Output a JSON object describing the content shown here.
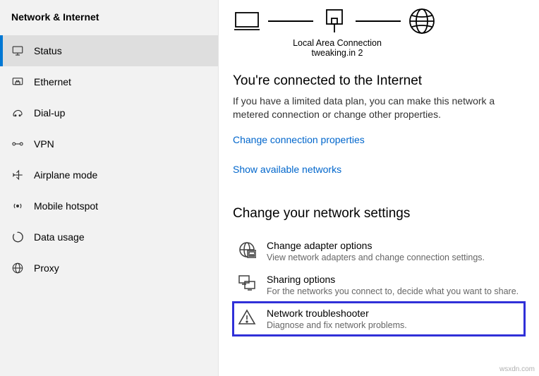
{
  "sidebar": {
    "title": "Network & Internet",
    "items": [
      {
        "label": "Status"
      },
      {
        "label": "Ethernet"
      },
      {
        "label": "Dial-up"
      },
      {
        "label": "VPN"
      },
      {
        "label": "Airplane mode"
      },
      {
        "label": "Mobile hotspot"
      },
      {
        "label": "Data usage"
      },
      {
        "label": "Proxy"
      }
    ]
  },
  "diagram": {
    "caption_line1": "Local Area Connection",
    "caption_line2": "tweaking.in 2"
  },
  "connected": {
    "heading": "You're connected to the Internet",
    "body": "If you have a limited data plan, you can make this network a metered connection or change other properties."
  },
  "links": {
    "change_props": "Change connection properties",
    "show_networks": "Show available networks"
  },
  "settings": {
    "heading": "Change your network settings",
    "items": [
      {
        "title": "Change adapter options",
        "desc": "View network adapters and change connection settings."
      },
      {
        "title": "Sharing options",
        "desc": "For the networks you connect to, decide what you want to share."
      },
      {
        "title": "Network troubleshooter",
        "desc": "Diagnose and fix network problems."
      }
    ]
  },
  "watermark": "wsxdn.com"
}
